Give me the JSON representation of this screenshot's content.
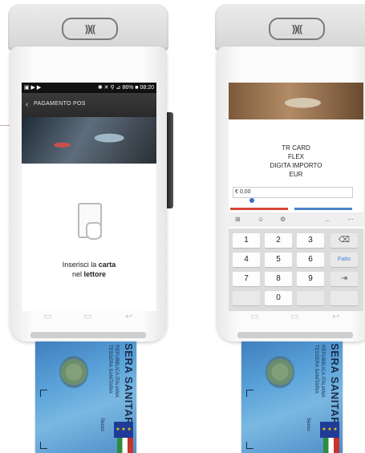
{
  "left_terminal": {
    "contactless_symbol": "))((",
    "status_bar": {
      "left_icons": "▣ ▶ ▶",
      "right_text": "✱ ✕ ⚲ ⊿ 86% ■ 08:20"
    },
    "header": {
      "back_icon": "chevron-left-icon",
      "title": "PAGAMENTO POS"
    },
    "instruction": {
      "line1_prefix": "Inserisci la ",
      "line1_bold": "carta",
      "line2_prefix": "nel ",
      "line2_bold": "lettore"
    }
  },
  "right_terminal": {
    "contactless_symbol": "))((",
    "card_info": {
      "line1": "TR CARD",
      "line2": "FLEX",
      "line3": "DIGITA IMPORTO",
      "line4": "EUR"
    },
    "amount_value": "€ 0,00",
    "keyboard_toolbar": [
      "⊞",
      "☺",
      "⚙",
      "",
      "...",
      "⋯"
    ],
    "keypad": {
      "row1": [
        "1",
        "2",
        "3"
      ],
      "row2": [
        "4",
        "5",
        "6"
      ],
      "row3": [
        "7",
        "8",
        "9"
      ],
      "row4": [
        "0"
      ],
      "backspace_label": "⌫",
      "done_label": "Fatto",
      "next_label": "⇥"
    }
  },
  "health_card": {
    "title": "SERA SANITARIA",
    "issuer_line1": "REPUBBLICA ITALIANA",
    "issuer_line2": "TESSERA SANITARIA",
    "sex_label": "Sesso",
    "eu_stars": "★ ★ ★"
  },
  "colors": {
    "accent_red": "#d6453a",
    "accent_blue": "#4a86c8",
    "done_blue": "#3a86d8"
  }
}
